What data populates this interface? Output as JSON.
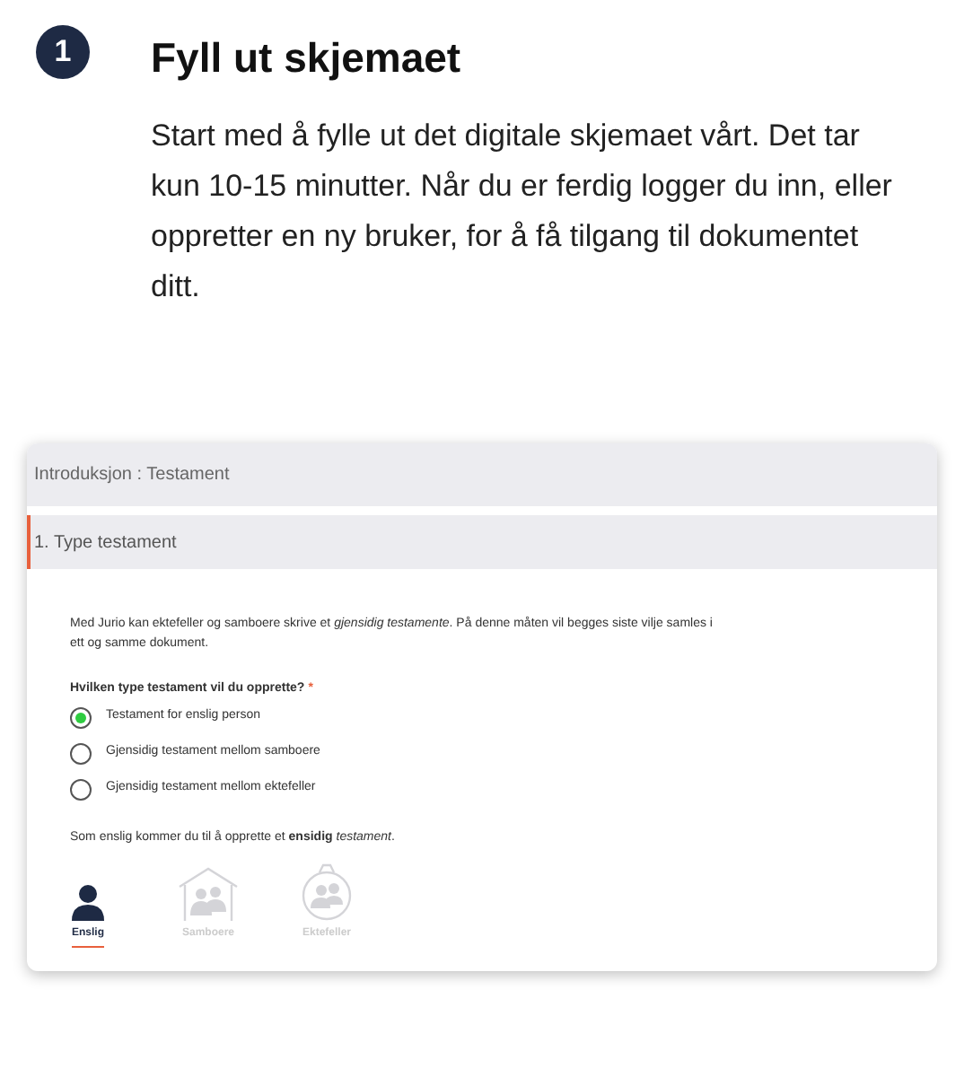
{
  "step": {
    "number": "1",
    "title": "Fyll ut skjemaet",
    "description": "Start med å fylle ut det digitale skjemaet vårt. Det tar kun 10-15 minutter. Når du er ferdig logger du inn, eller oppretter en ny bruker, for å få tilgang til dokumentet ditt."
  },
  "form": {
    "header": "Introduksjon : Testament",
    "section": "1. Type testament",
    "intro": "Med Jurio kan ektefeller og samboere skrive et *gjensidig testamente*. På denne måten vil begges siste vilje samles i ett og samme dokument.",
    "question": "Hvilken type testament vil du opprette?",
    "required_mark": "*",
    "options": [
      {
        "label": "Testament for enslig person",
        "selected": true
      },
      {
        "label": "Gjensidig testament mellom samboere",
        "selected": false
      },
      {
        "label": "Gjensidig testament mellom ektefeller",
        "selected": false
      }
    ],
    "summary": "Som enslig kommer du til å opprette et **ensidig** *testament*.",
    "types": [
      {
        "kind": "single",
        "label": "Enslig",
        "selected": true
      },
      {
        "kind": "cohabitants",
        "label": "Samboere",
        "selected": false
      },
      {
        "kind": "spouses",
        "label": "Ektefeller",
        "selected": false
      }
    ]
  }
}
